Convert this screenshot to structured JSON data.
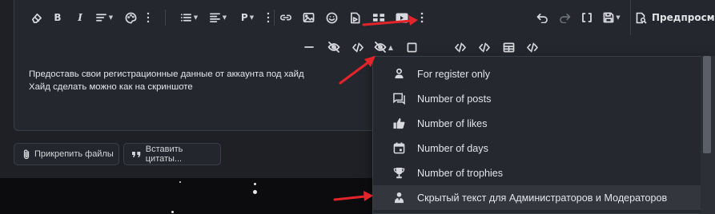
{
  "toolbar": {
    "bold_label": "B",
    "italic_label": "I",
    "paragraph_label": "P",
    "preview_label": "Предпросм"
  },
  "content": {
    "line1": "Предоставь свои регистрационные данные от аккаунта под хайд",
    "line2": "Хайд сделать можно как на скриншоте"
  },
  "attach": {
    "attach_files_label": "Прикрепить файлы",
    "insert_quotes_label": "Вставить цитаты..."
  },
  "hide_menu": {
    "items": [
      {
        "label": "For register only",
        "icon": "user-icon"
      },
      {
        "label": "Number of posts",
        "icon": "comments-icon"
      },
      {
        "label": "Number of likes",
        "icon": "thumbs-up-icon"
      },
      {
        "label": "Number of days",
        "icon": "calendar-icon"
      },
      {
        "label": "Number of trophies",
        "icon": "trophy-icon"
      },
      {
        "label": "Скрытый текст для Администраторов и Модераторов",
        "icon": "user-tie-icon"
      }
    ]
  },
  "colors": {
    "background": "#1e2025",
    "editor": "#24272d",
    "menu": "#25282e",
    "highlight": "#33363d",
    "annotation_red": "#e3242b"
  }
}
